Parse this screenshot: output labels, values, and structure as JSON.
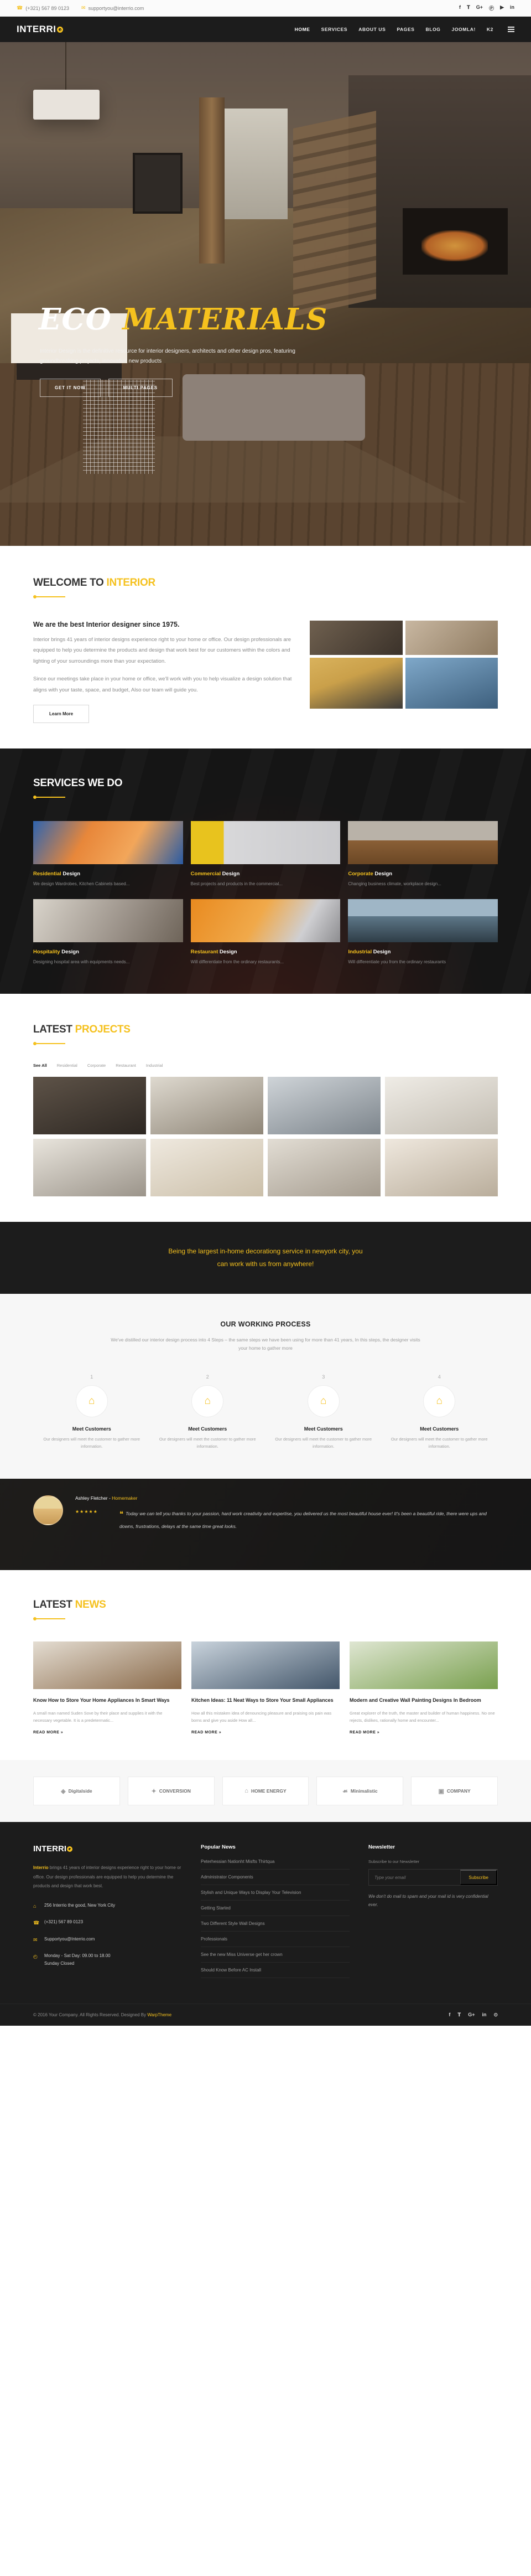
{
  "topbar": {
    "phone": "(+321) 567 89 0123",
    "email": "supportyou@interrio.com",
    "phone_icon": "phone-icon",
    "email_icon": "envelope-icon",
    "social": [
      "f",
      "𝐓",
      "G+",
      "Ⓟ",
      "▶",
      "in"
    ]
  },
  "nav": {
    "logo": "INTERRI",
    "items": [
      {
        "label": "HOME",
        "active": true
      },
      {
        "label": "SERVICES",
        "active": false
      },
      {
        "label": "ABOUT US",
        "active": false
      },
      {
        "label": "PAGES",
        "active": false
      },
      {
        "label": "BLOG",
        "active": false
      },
      {
        "label": "JOOMLA!",
        "active": false
      },
      {
        "label": "K2",
        "active": false
      }
    ]
  },
  "hero": {
    "title_white": "ECO",
    "title_accent": "MATERIALS",
    "subtitle": "Interior Design is the definitive resource for interior designers, architects and other design pros, featuring groundbreaking projects, innovative new products",
    "btn_primary": "GET IT NOW",
    "btn_secondary": "MULTI PAGES"
  },
  "welcome": {
    "head_dark": "WELCOME TO",
    "head_accent": "INTERIOR",
    "subhead": "We are the best Interior designer since 1975.",
    "p1": "Interior brings 41 years of interior designs experience right to your home or office. Our design professionals are equipped to help you determine the products and design that work best for our customers within the colors and lighting of your surroundings more than your expectation.",
    "p2": "Since our meetings take place in your home or office, we'll work with you to help visualize a design solution that aligns with your taste, space, and budget, Also our team will guide you.",
    "button": "Learn More"
  },
  "services": {
    "heading": "SERVICES WE DO",
    "cards": [
      {
        "hi": "Residential",
        "rest": " Design",
        "desc": "We design Wardrobes, Kitchen Cabinets based..."
      },
      {
        "hi": "Commercial",
        "rest": " Design",
        "desc": "Best projects and products in the commercial..."
      },
      {
        "hi": "Corporate",
        "rest": " Design",
        "desc": "Changing business climate, workplace design..."
      },
      {
        "hi": "Hospitality",
        "rest": " Design",
        "desc": "Designing hospital area with equipments needs..."
      },
      {
        "hi": "Restaurant",
        "rest": " Design",
        "desc": "Will differentiate from the ordinary restaurants..."
      },
      {
        "hi": "Industrial",
        "rest": " Design",
        "desc": "Will differentiate you from the ordinary restaurants"
      }
    ]
  },
  "projects": {
    "head_dark": "LATEST",
    "head_accent": "PROJECTS",
    "filters": [
      {
        "label": "See All",
        "active": true
      },
      {
        "label": "Residential",
        "active": false
      },
      {
        "label": "Corporate",
        "active": false
      },
      {
        "label": "Restaurant",
        "active": false
      },
      {
        "label": "Industrial",
        "active": false
      }
    ]
  },
  "cta": {
    "line1": "Being the largest in-home decorationg service in newyork city, you",
    "line2": "can work with us from anywhere!"
  },
  "process": {
    "heading": "OUR WORKING PROCESS",
    "lead": "We've distilled our interior design process into 4 Steps – the same steps we have been using for more than 41 years, In this steps, the designer visits your home to gather more",
    "steps": [
      {
        "num": "1",
        "icon": "home-icon",
        "title": "Meet Customers",
        "desc": "Our designers will meet the customer to gather more information."
      },
      {
        "num": "2",
        "icon": "home-icon",
        "title": "Meet Customers",
        "desc": "Our designers will meet the customer to gather more information."
      },
      {
        "num": "3",
        "icon": "home-icon",
        "title": "Meet Customers",
        "desc": "Our designers will meet the customer to gather more information."
      },
      {
        "num": "4",
        "icon": "home-icon",
        "title": "Meet Customers",
        "desc": "Our designers will meet the customer to gather more information."
      }
    ]
  },
  "testimonial": {
    "name": "Ashley Fletcher - ",
    "role": "Homemaker",
    "stars": "★★★★★",
    "quote": "Today we can tell you thanks to your passion, hard work creativity and expertise, you delivered us the most beautiful house ever! It's been a beautiful ride, there were ups and downs, frustrations, delays at the same time great looks."
  },
  "news": {
    "head_dark": "LATEST",
    "head_accent": "NEWS",
    "items": [
      {
        "title": "Know How to Store Your Home Appliances In Smart Ways",
        "desc": "A small man named Suden Sove by their place and supplies it with the necessary vegetable. It is a predetermatic...",
        "more": "READ MORE »"
      },
      {
        "title": "Kitchen Ideas: 11 Neat Ways to Store Your Small Appliances",
        "desc": "How all this mistaken idea of denouncing pleasure and praising ois pain was borns and give you aside How all...",
        "more": "READ MORE »"
      },
      {
        "title": "Modern and Creative Wall Painting Designs In Bedroom",
        "desc": "Great explorer of the truth, the master and builder of human happiness. No one rejects, dislikes, rationally home and encounter...",
        "more": "READ MORE »"
      }
    ]
  },
  "brands": [
    {
      "icon": "◈",
      "label": "Digitalside"
    },
    {
      "icon": "✦",
      "label": "CONVERSION"
    },
    {
      "icon": "⌂",
      "label": "HOME ENERGY"
    },
    {
      "icon": "☙",
      "label": "Minimalistic"
    },
    {
      "icon": "▣",
      "label": "COMPANY"
    }
  ],
  "footer": {
    "logo": "INTERRI",
    "about_brand": "Interrio",
    "about": " brings 41 years of interior designs experience right to your home or office. Our design professionals are equipped to help you determine the products and design that work best.",
    "contacts": [
      {
        "icon": "location-icon",
        "glyph": "⌂",
        "text": "256 Interrio the good, New York City"
      },
      {
        "icon": "phone-icon",
        "glyph": "☎",
        "text": "(+321) 567 89 0123"
      },
      {
        "icon": "envelope-icon",
        "glyph": "✉",
        "text": "Supportyou@Interrio.com"
      },
      {
        "icon": "clock-icon",
        "glyph": "◴",
        "text": "Monday - Sat Day: 09.00 to 18.00\nSunday Closed"
      }
    ],
    "popular_heading": "Popular News",
    "popular": [
      "Peterhessian Nationht Misfts Thirtqua",
      "Administrator Components",
      "Stylish and Unique Ways to Display Your Television",
      "Getting Started",
      "Two Different Style Wall Designs",
      "Professionals",
      "See the new Miss Universe get her crown",
      "Should Know Before AC Install"
    ],
    "newsletter_heading": "Newsletter",
    "newsletter_sub": "Subscribe to our Newsletter",
    "newsletter_placeholder": "Type your email",
    "newsletter_value": "",
    "subscribe": "Subscribe",
    "newsletter_note": "We don't do mail to spam and your mail id is very confidential ever.",
    "copyright": "© 2016 Your Company. All Rights Reserved. Designed By ",
    "copyright_brand": "WarpTheme",
    "social": [
      "f",
      "𝐓",
      "G+",
      "in",
      "⊙"
    ]
  },
  "colors": {
    "accent": "#f5c11e",
    "dark": "#1c1c1c",
    "gray": "#9a9a9a"
  }
}
